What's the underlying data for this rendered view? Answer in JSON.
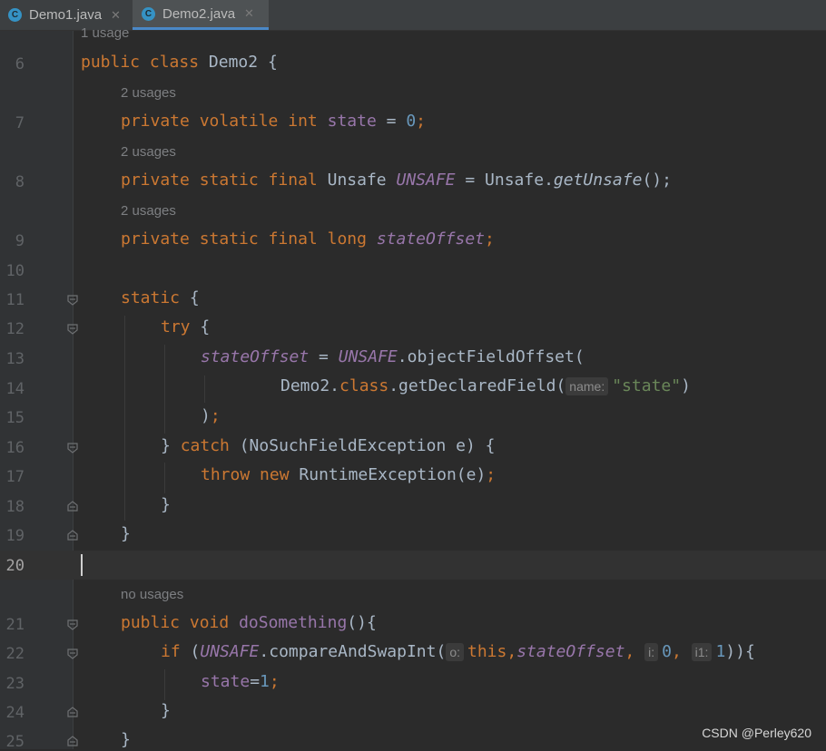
{
  "tabs": [
    {
      "label": "Demo1.java",
      "icon": "class-c-icon",
      "active": false
    },
    {
      "label": "Demo2.java",
      "icon": "class-c-icon",
      "active": true
    }
  ],
  "editor": {
    "usage_1": "1 usage",
    "usage_2": "2 usages",
    "usage_3": "2 usages",
    "usage_4": "2 usages",
    "usage_5": "no usages",
    "line_numbers": [
      "6",
      "7",
      "8",
      "9",
      "10",
      "11",
      "12",
      "13",
      "14",
      "15",
      "16",
      "17",
      "18",
      "19",
      "20",
      "21",
      "22",
      "23",
      "24",
      "25"
    ],
    "tokens": {
      "public": "public",
      "class": "class",
      "Demo2": "Demo2",
      "brace_open": "{",
      "private": "private",
      "volatile": "volatile",
      "int": "int",
      "state": "state",
      "eq": " = ",
      "zero": "0",
      "semi": ";",
      "static": "static",
      "final": "final",
      "Unsafe": "Unsafe",
      "UNSAFE": "UNSAFE",
      "getUnsafe": "getUnsafe",
      "dot": ".",
      "parens_semi": "();",
      "long": "long",
      "stateOffset": "stateOffset",
      "try": "try",
      "objectFieldOffset": "objectFieldOffset(",
      "Demo2_class": "Demo2.",
      "class_kw": "class",
      "getDeclaredField": ".getDeclaredField(",
      "hint_name": "name:",
      "state_str": "\"state\"",
      "close_paren": ")",
      "close_paren_semi": ");",
      "brace_close": "}",
      "catch": "catch",
      "catch_args": "(NoSuchFieldException e) {",
      "throw": "throw",
      "new": "new",
      "RuntimeException": "RuntimeException(e)",
      "void": "void",
      "doSomething": "doSomething",
      "method_tail": "(){",
      "if": "if",
      "if_open": " (",
      "compareAndSwapInt": ".compareAndSwapInt(",
      "hint_o": "o:",
      "this": "this",
      "comma": ",",
      "hint_i": "i:",
      "hint_i1": "i1:",
      "one": "1",
      "if_tail": ")){",
      "state_assign": "state",
      "assign_eq": "=",
      "one_val": "1"
    }
  },
  "watermark": "CSDN @Perley620"
}
